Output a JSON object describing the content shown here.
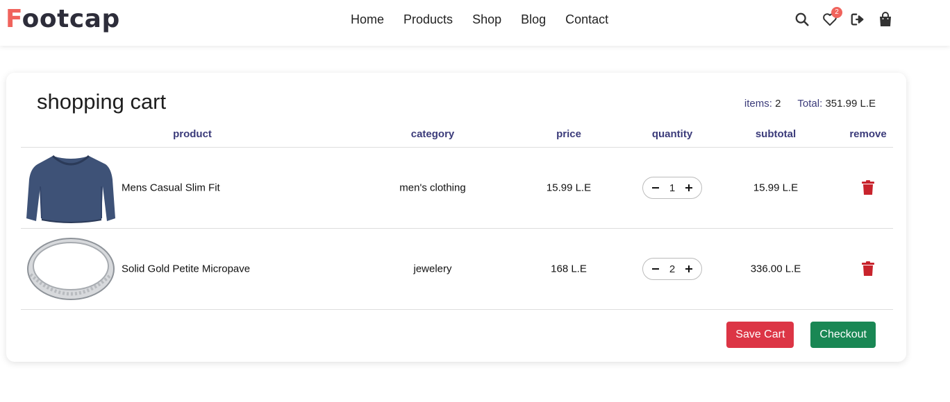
{
  "brand": {
    "first_letter": "F",
    "rest": "ootcap",
    "accent_color": "#f0635c"
  },
  "nav": {
    "links": [
      "Home",
      "Products",
      "Shop",
      "Blog",
      "Contact"
    ],
    "icons": [
      "search-icon",
      "heart-icon",
      "logout-icon",
      "shopping-bag-icon"
    ],
    "wishlist_count": "2"
  },
  "cart": {
    "title": "shopping cart",
    "items_label": "items:",
    "items_count": "2",
    "total_label": "Total:",
    "total_value": "351.99 L.E",
    "columns": [
      "product",
      "category",
      "price",
      "quantity",
      "subtotal",
      "remove"
    ],
    "rows": [
      {
        "name": "Mens Casual Slim Fit",
        "image": "long-sleeve-shirt",
        "category": "men's clothing",
        "price": "15.99 L.E",
        "quantity": "1",
        "subtotal": "15.99 L.E"
      },
      {
        "name": "Solid Gold Petite Micropave",
        "image": "silver-ring",
        "category": "jewelery",
        "price": "168 L.E",
        "quantity": "2",
        "subtotal": "336.00 L.E"
      }
    ],
    "save_label": "Save Cart",
    "checkout_label": "Checkout"
  },
  "colors": {
    "header_text": "#3b3b7a",
    "danger": "#dc3545",
    "success": "#198754",
    "trash": "#c8232c"
  }
}
